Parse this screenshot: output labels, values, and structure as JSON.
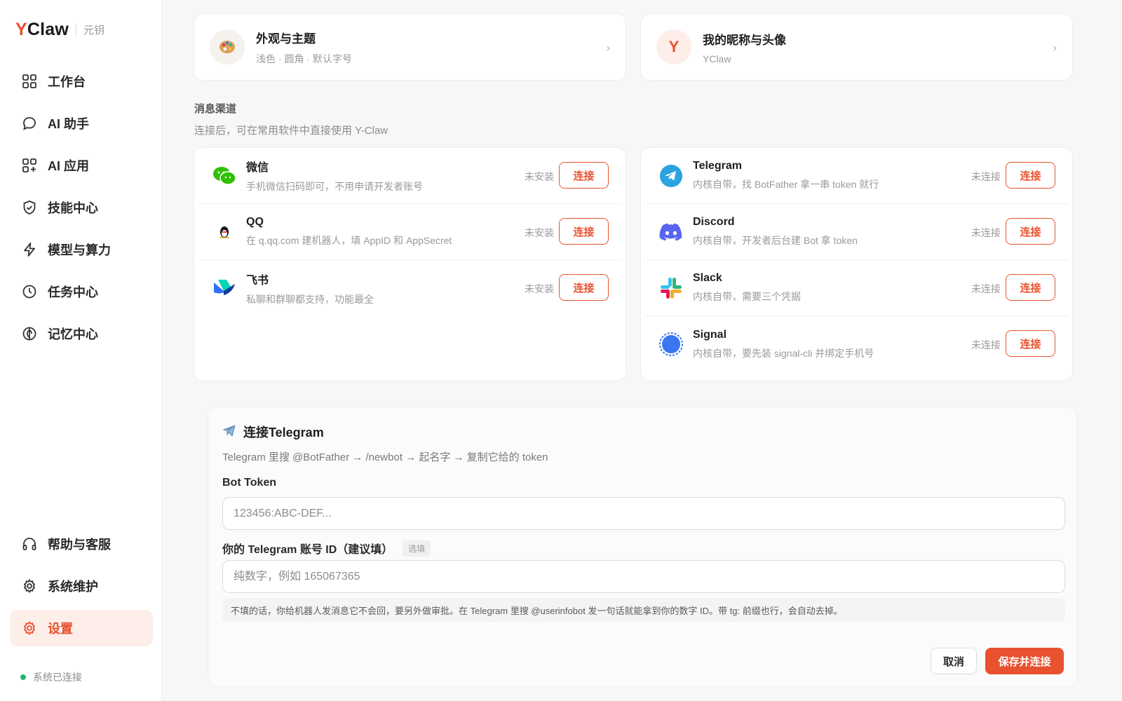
{
  "brand": {
    "name_y": "Y",
    "name_rest": "Claw",
    "subtitle": "元钥"
  },
  "nav": {
    "items": [
      {
        "label": "工作台",
        "icon": "grid-icon"
      },
      {
        "label": "AI 助手",
        "icon": "chat-bubble-icon"
      },
      {
        "label": "AI 应用",
        "icon": "apps-icon"
      },
      {
        "label": "技能中心",
        "icon": "shield-check-icon"
      },
      {
        "label": "模型与算力",
        "icon": "lightning-icon"
      },
      {
        "label": "任务中心",
        "icon": "clock-icon"
      },
      {
        "label": "记忆中心",
        "icon": "memory-icon"
      }
    ],
    "bottom": [
      {
        "label": "帮助与客服",
        "icon": "headphones-icon"
      },
      {
        "label": "系统维护",
        "icon": "gear-icon"
      },
      {
        "label": "设置",
        "icon": "settings-icon",
        "active": true
      }
    ],
    "status": "系统已连接"
  },
  "prefs": {
    "appearance": {
      "title": "外观与主题",
      "subtitle": "浅色 · 圆角 · 默认字号"
    },
    "profile": {
      "avatar": "Y",
      "title": "我的昵称与头像",
      "subtitle": "YClaw"
    }
  },
  "channels": {
    "title": "消息渠道",
    "subtitle": "连接后，可在常用软件中直接使用 Y-Claw",
    "connect_label": "连接",
    "left": [
      {
        "name": "微信",
        "desc": "手机微信扫码即可，不用申请开发者账号",
        "status": "未安装",
        "icon": "wechat-icon"
      },
      {
        "name": "QQ",
        "desc": "在 q.qq.com 建机器人，填 AppID 和 AppSecret",
        "status": "未安装",
        "icon": "qq-penguin-icon"
      },
      {
        "name": "飞书",
        "desc": "私聊和群聊都支持，功能最全",
        "status": "未安装",
        "icon": "feishu-icon"
      }
    ],
    "right": [
      {
        "name": "Telegram",
        "desc": "内核自带，找 BotFather 拿一串 token 就行",
        "status": "未连接",
        "icon": "telegram-icon"
      },
      {
        "name": "Discord",
        "desc": "内核自带，开发者后台建 Bot 拿 token",
        "status": "未连接",
        "icon": "discord-icon"
      },
      {
        "name": "Slack",
        "desc": "内核自带，需要三个凭据",
        "status": "未连接",
        "icon": "slack-icon"
      },
      {
        "name": "Signal",
        "desc": "内核自带，要先装 signal-cli 并绑定手机号",
        "status": "未连接",
        "icon": "signal-icon"
      }
    ]
  },
  "form": {
    "title": "连接Telegram",
    "hint": "Telegram 里搜 @BotFather → /newbot → 起名字 → 复制它给的 token",
    "token_label": "Bot Token",
    "token_placeholder": "123456:ABC-DEF...",
    "id_label": "你的 Telegram 账号 ID（建议填）",
    "id_tag": "选填",
    "id_placeholder": "纯数字，例如 165067365",
    "note": "不填的话，你给机器人发消息它不会回，要另外做审批。在 Telegram 里搜 @userinfobot 发一句话就能拿到你的数字 ID。带 tg: 前缀也行，会自动去掉。",
    "cancel": "取消",
    "save": "保存并连接"
  },
  "colors": {
    "accent": "#e8522e",
    "status_ok": "#22b573"
  }
}
